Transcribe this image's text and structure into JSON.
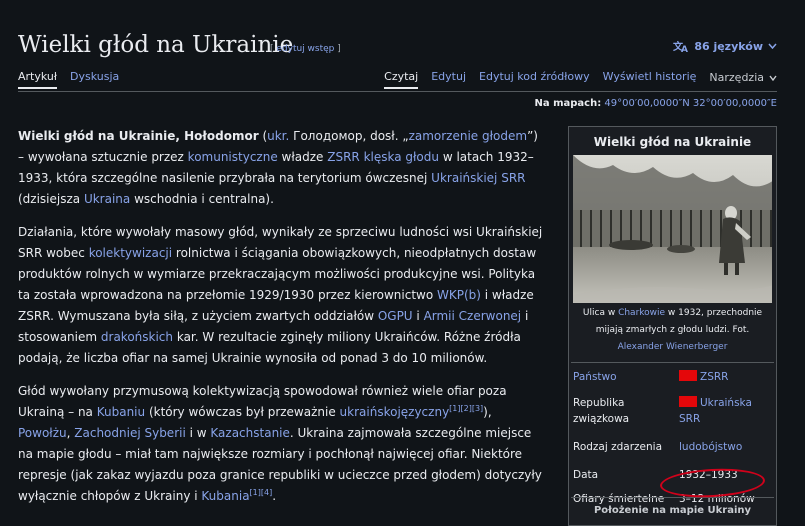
{
  "header": {
    "title": "Wielki głód na Ukrainie",
    "edit_intro_open": "[ ",
    "edit_intro": "edytuj wstęp",
    "edit_intro_close": " ]",
    "languages": "86 języków"
  },
  "tabs": {
    "left": [
      "Artykuł",
      "Dyskusja"
    ],
    "right": [
      "Czytaj",
      "Edytuj",
      "Edytuj kod źródłowy",
      "Wyświetl historię"
    ],
    "tools": "Narzędzia"
  },
  "coords": {
    "label": "Na mapach:",
    "value": "49°00′00,0000″N 32°00′00,0000″E"
  },
  "article": {
    "p1": {
      "bold": "Wielki głód na Ukrainie, Hołodomor",
      "t1": " (",
      "l_ukr": "ukr.",
      "t2": " Голодомор, dosł. „",
      "l_zam": "zamorzenie głodem",
      "t3": "”) – wywołana sztucznie przez ",
      "l_kom": "komunistyczne",
      "t4": " władze ",
      "l_zsrr": "ZSRR",
      "t5": " ",
      "l_kleska": "klęska głodu",
      "t6": " w latach 1932–1933, która szczególne nasilenie przybrała na terytorium ówczesnej ",
      "l_usrr": "Ukraińskiej SRR",
      "t7": " (dzisiejsza ",
      "l_ukraina": "Ukraina",
      "t8": " wschodnia i centralna)."
    },
    "p2": {
      "t1": "Działania, które wywołały masowy głód, wynikały ze sprzeciwu ludności wsi Ukraińskiej SRR wobec ",
      "l_kol": "kolektywizacji",
      "t2": " rolnictwa i ściągania obowiązkowych, nieodpłatnych dostaw produktów rolnych w wymiarze przekraczającym możliwości produkcyjne wsi. Polityka ta została wprowadzona na przełomie 1929/1930 przez kierownictwo ",
      "l_wkp": "WKP(b)",
      "t3": " i władze ZSRR. Wymuszana była siłą, z użyciem zwartych oddziałów ",
      "l_ogpu": "OGPU",
      "t4": " i ",
      "l_armii": "Armii Czerwonej",
      "t5": " i stosowaniem ",
      "l_drak": "drakońskich",
      "t6": " kar. W rezultacie zginęły miliony Ukraińców. Różne źródła podają, że liczba ofiar na samej Ukrainie wynosiła od ponad 3 do 10 milionów."
    },
    "p3": {
      "t1": "Głód wywołany przymusową kolektywizacją spowodował również wiele ofiar poza Ukrainą – na ",
      "l_kuban": "Kubaniu",
      "t2": " (który wówczas był przeważnie ",
      "l_ukrj": "ukraińskojęzyczny",
      "sup1": "[1][2][3]",
      "t3": "), ",
      "l_powolze": "Powołżu",
      "t4": ", ",
      "l_syb": "Zachodniej Syberii",
      "t5": " i w ",
      "l_kaz": "Kazachstanie",
      "t6": ". Ukraina zajmowała szczególne miejsce na mapie głodu – miał tam największe rozmiary i pochłonął najwięcej ofiar. Niektóre represje (jak zakaz wyjazdu poza granice republiki w ucieczce przed głodem) dotyczyły wyłącznie chłopów z Ukrainy i ",
      "l_kubania": "Kubania",
      "sup2": "[1][4]",
      "t7": "."
    }
  },
  "infobox": {
    "title": "Wielki głód na Ukrainie",
    "caption_pre": "Ulica w ",
    "caption_link": "Charkowie",
    "caption_post": " w 1932, przechodnie mijają zmarłych z głodu ludzi. Fot. ",
    "caption_author": "Alexander Wienerberger",
    "rows": [
      {
        "label": "Państwo",
        "value": "ZSRR"
      },
      {
        "label": "Republika związkowa",
        "value": "Ukraińska SRR"
      },
      {
        "label": "Rodzaj zdarzenia",
        "value": "ludobójstwo"
      },
      {
        "label": "Data",
        "value": "1932–1933"
      },
      {
        "label": "Ofiary śmiertelne",
        "value": "3–12 milionów"
      }
    ],
    "footer": "Położenie na mapie Ukrainy"
  },
  "colors": {
    "background": "#101418",
    "text": "#eaecf0",
    "link": "#88a3e8",
    "flag": "#e4070a",
    "annotation": "#d0021b"
  }
}
